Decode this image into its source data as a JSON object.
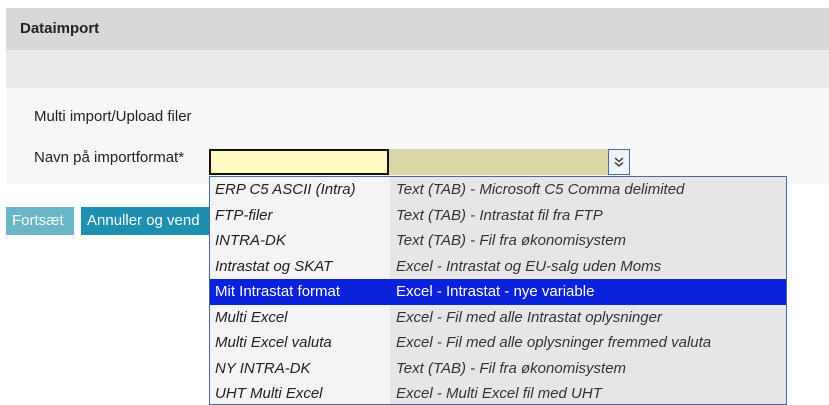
{
  "header": {
    "title": "Dataimport"
  },
  "section": {
    "label": "Multi import/Upload filer"
  },
  "field": {
    "label": "Navn på importformat*",
    "value": ""
  },
  "buttons": {
    "continue": "Fortsæt",
    "cancel": "Annuller og vend"
  },
  "dropdown": {
    "selected_index": 4,
    "options": [
      {
        "name": "ERP C5 ASCII (Intra)",
        "desc": "Text (TAB) - Microsoft C5 Comma delimited"
      },
      {
        "name": "FTP-filer",
        "desc": "Text (TAB) - Intrastat fil fra FTP"
      },
      {
        "name": "INTRA-DK",
        "desc": "Text (TAB) - Fil fra økonomisystem"
      },
      {
        "name": "Intrastat og SKAT",
        "desc": "Excel - Intrastat og EU-salg uden Moms"
      },
      {
        "name": "Mit Intrastat format",
        "desc": "Excel - Intrastat - nye variable"
      },
      {
        "name": "Multi Excel",
        "desc": "Excel - Fil med alle Intrastat oplysninger"
      },
      {
        "name": "Multi Excel valuta",
        "desc": "Excel - Fil med alle oplysninger fremmed valuta"
      },
      {
        "name": "NY INTRA-DK",
        "desc": "Text (TAB) - Fil fra økonomisystem"
      },
      {
        "name": "UHT Multi Excel",
        "desc": "Excel - Multi Excel fil med UHT"
      }
    ]
  },
  "colors": {
    "highlight": "#0b22dc",
    "input_bg": "#fdfbc0",
    "button_primary": "#1f8fb0"
  }
}
